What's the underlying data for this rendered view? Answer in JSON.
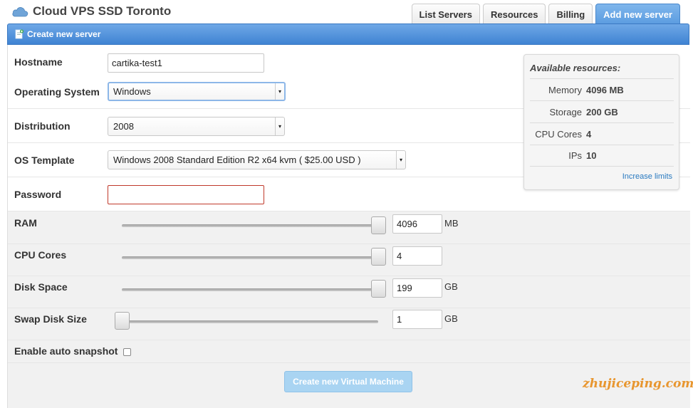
{
  "header": {
    "title": "Cloud VPS SSD Toronto",
    "tabs": [
      {
        "label": "List Servers",
        "active": false
      },
      {
        "label": "Resources",
        "active": false
      },
      {
        "label": "Billing",
        "active": false
      },
      {
        "label": "Add new server",
        "active": true
      }
    ]
  },
  "panel": {
    "title": "Create new server"
  },
  "form": {
    "hostname": {
      "label": "Hostname",
      "value": "cartika-test1"
    },
    "os": {
      "label": "Operating System",
      "selected": "Windows"
    },
    "distribution": {
      "label": "Distribution",
      "selected": "2008"
    },
    "template": {
      "label": "OS Template",
      "selected": "Windows 2008 Standard Edition R2 x64 kvm ( $25.00 USD )"
    },
    "password": {
      "label": "Password",
      "value": ""
    },
    "ram": {
      "label": "RAM",
      "value": "4096",
      "unit": "MB",
      "fraction": 1.0
    },
    "cpu": {
      "label": "CPU Cores",
      "value": "4",
      "unit": "",
      "fraction": 1.0
    },
    "disk": {
      "label": "Disk Space",
      "value": "199",
      "unit": "GB",
      "fraction": 1.0
    },
    "swap": {
      "label": "Swap Disk Size",
      "value": "1",
      "unit": "GB",
      "fraction": 0.0
    },
    "snapshot": {
      "label": "Enable auto snapshot",
      "checked": false
    },
    "submit_label": "Create new Virtual Machine"
  },
  "resources": {
    "title": "Available resources:",
    "items": [
      {
        "name": "Memory",
        "value": "4096 MB"
      },
      {
        "name": "Storage",
        "value": "200 GB"
      },
      {
        "name": "CPU Cores",
        "value": "4"
      },
      {
        "name": "IPs",
        "value": "10"
      }
    ],
    "link_label": "Increase limits"
  },
  "watermark": "zhujiceping.com",
  "colors": {
    "accent": "#4f94de",
    "button_disabled": "#a9d4f2",
    "error_border": "#c0392b",
    "link": "#2a7ac0"
  },
  "icons": {
    "app": "cloud-icon",
    "panel": "document-add-icon",
    "select_caret": "caret-icon"
  }
}
